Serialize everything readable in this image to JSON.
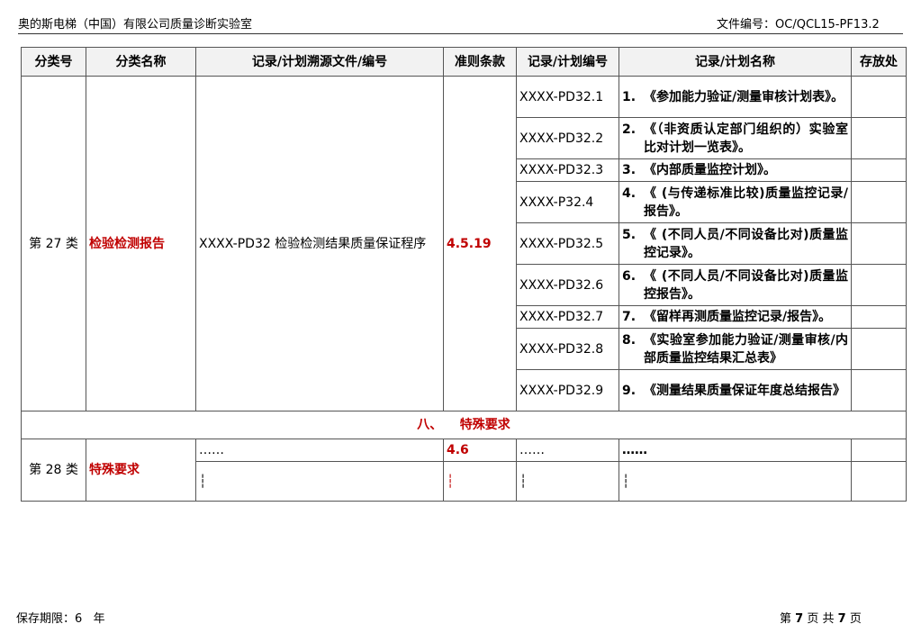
{
  "header": {
    "company": "奥的斯电梯（中国）有限公司质量诊断实验室",
    "file_no_label": "文件编号：",
    "file_no": "OC/QCL15-PF13.2"
  },
  "table": {
    "headers": [
      "分类号",
      "分类名称",
      "记录/计划溯源文件/编号",
      "准则条款",
      "记录/计划编号",
      "记录/计划名称",
      "存放处"
    ],
    "group27": {
      "class_no": "第 27 类",
      "class_name": "检验检测报告",
      "source": "XXXX-PD32 检验检测结果质量保证程序",
      "clause": "4.5.19",
      "records": [
        {
          "code": "XXXX-PD32.1",
          "num": "1.",
          "name": "《参加能力验证/测量审核计划表》。"
        },
        {
          "code": "XXXX-PD32.2",
          "num": "2.",
          "name": "《（非资质认定部门组织的）实验室比对计划一览表》。"
        },
        {
          "code": "XXXX-PD32.3",
          "num": "3.",
          "name": "《内部质量监控计划》。"
        },
        {
          "code": "XXXX-P32.4",
          "num": "4.",
          "name": "《 (与传递标准比较)质量监控记录/报告》。"
        },
        {
          "code": "XXXX-PD32.5",
          "num": "5.",
          "name": "《 (不同人员/不同设备比对)质量监控记录》。"
        },
        {
          "code": "XXXX-PD32.6",
          "num": "6.",
          "name": "《 (不同人员/不同设备比对)质量监控报告》。"
        },
        {
          "code": "XXXX-PD32.7",
          "num": "7.",
          "name": "《留样再测质量监控记录/报告》。"
        },
        {
          "code": "XXXX-PD32.8",
          "num": "8.",
          "name": "《实验室参加能力验证/测量审核/内部质量监控结果汇总表》"
        },
        {
          "code": "XXXX-PD32.9",
          "num": "9.",
          "name": "《测量结果质量保证年度总结报告》"
        }
      ]
    },
    "section_title": "八、    特殊要求",
    "group28": {
      "class_no": "第 28 类",
      "class_name": "特殊要求",
      "source": "……",
      "clause": "4.6",
      "code": "……",
      "name": "……",
      "cont": "┆"
    }
  },
  "footer": {
    "retention": "保存期限：6   年",
    "page_prefix": "第",
    "page_cur": "7",
    "page_mid": "页  共",
    "page_total": "7",
    "page_suffix": "页"
  }
}
